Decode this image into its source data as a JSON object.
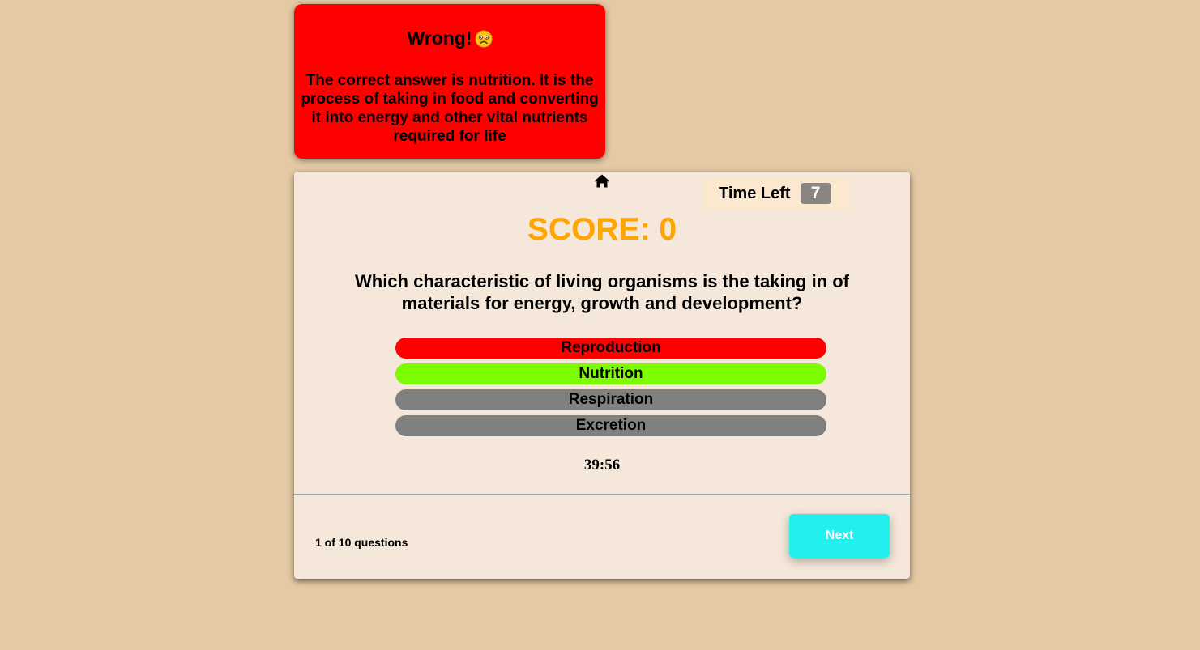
{
  "feedback": {
    "title": "Wrong!",
    "icon": "sad-face-icon",
    "message": "The correct answer is nutrition. It is the process of taking in food and converting it into energy and other vital nutrients required for life",
    "background_color": "#ff0000"
  },
  "quiz": {
    "home_icon": "home-icon",
    "timer": {
      "label": "Time Left",
      "value": "7"
    },
    "score_text": "SCORE: 0",
    "question": "Which characteristic of living organisms is the taking in of materials for energy, growth and development?",
    "options": [
      {
        "label": "Reproduction",
        "state": "wrong",
        "color": "#ff0000"
      },
      {
        "label": "Nutrition",
        "state": "correct",
        "color": "#7cfc00"
      },
      {
        "label": "Respiration",
        "state": "disabled",
        "color": "#808080"
      },
      {
        "label": "Excretion",
        "state": "disabled",
        "color": "#808080"
      }
    ],
    "clock": "39:56",
    "progress": "1 of 10 questions",
    "next_label": "Next",
    "colors": {
      "score": "#ffa500",
      "next_button": "#22f0ef"
    }
  }
}
